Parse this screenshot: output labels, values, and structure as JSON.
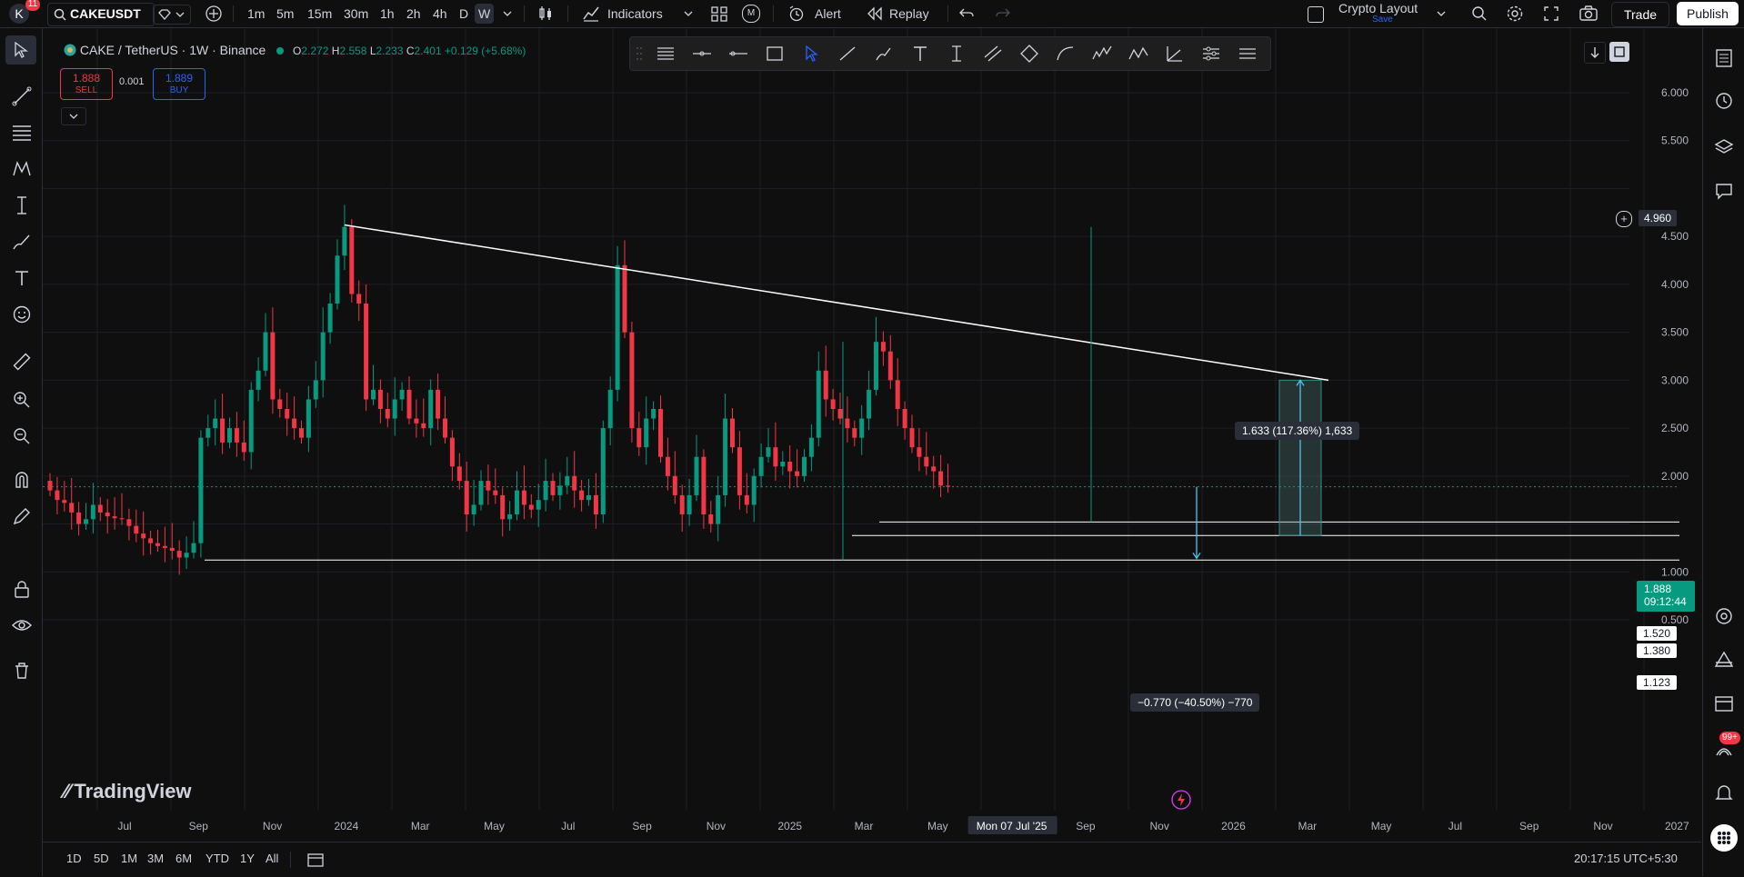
{
  "header": {
    "avatar_letter": "K",
    "notif_count": "11",
    "symbol": "CAKEUSDT",
    "intervals": [
      "1m",
      "5m",
      "15m",
      "30m",
      "1h",
      "2h",
      "4h",
      "D",
      "W"
    ],
    "active_interval": "W",
    "indicators_label": "Indicators",
    "alert_label": "Alert",
    "replay_label": "Replay",
    "layout_name": "Crypto Layout",
    "layout_sub": "Save",
    "trade_label": "Trade",
    "publish_label": "Publish"
  },
  "legend": {
    "title": "CAKE / TetherUS · 1W · Binance",
    "open_label": "O",
    "open": "2.272",
    "high_label": "H",
    "high": "2.558",
    "low_label": "L",
    "low": "2.233",
    "close_label": "C",
    "close": "2.401",
    "change": "+0.129 (+5.68%)"
  },
  "order": {
    "sell_price": "1.888",
    "sell_label": "SELL",
    "spread": "0.001",
    "buy_price": "1.889",
    "buy_label": "BUY"
  },
  "price_axis": [
    "6.000",
    "5.500",
    "4.500",
    "4.000",
    "3.500",
    "3.000",
    "2.500",
    "2.000",
    "1.000",
    "0.500"
  ],
  "crosshair_price": "4.960",
  "current_price": "1.888",
  "countdown": "09:12:44",
  "level_tags": [
    "1.520",
    "1.380",
    "1.123"
  ],
  "time_axis": [
    "Jul",
    "Sep",
    "Nov",
    "2024",
    "Mar",
    "May",
    "Jul",
    "Sep",
    "Nov",
    "2025",
    "Mar",
    "May",
    "Mon 07 Jul '25",
    "Sep",
    "Nov",
    "2026",
    "Mar",
    "May",
    "Jul",
    "Sep",
    "Nov",
    "2027"
  ],
  "callouts": {
    "up": "1.633 (117.36%) 1,633",
    "down": "−0.770 (−40.50%) −770"
  },
  "watermark": "TradingView",
  "ranges": [
    "1D",
    "5D",
    "1M",
    "3M",
    "6M",
    "YTD",
    "1Y",
    "All"
  ],
  "clock": "20:17:15 UTC+5:30",
  "badge_99": "99+",
  "colors": {
    "up": "#089981",
    "down": "#f23645",
    "bg": "#0f0f0f",
    "line": "#ffffff",
    "accent": "#2962ff"
  },
  "chart_data": {
    "type": "candlestick",
    "title": "CAKE / TetherUS · 1W · Binance",
    "ylim": [
      0.3,
      6.2
    ],
    "trendline": {
      "from_price": 4.62,
      "to_price": 3.0
    },
    "horizontal_levels": [
      1.52,
      1.38,
      1.123
    ],
    "closes": [
      1.85,
      1.75,
      1.72,
      1.62,
      1.5,
      1.55,
      1.7,
      1.62,
      1.58,
      1.56,
      1.55,
      1.48,
      1.4,
      1.35,
      1.3,
      1.27,
      1.25,
      1.22,
      1.15,
      1.2,
      1.3,
      2.4,
      2.5,
      2.6,
      2.35,
      2.5,
      2.35,
      2.25,
      2.9,
      3.1,
      3.5,
      2.8,
      2.7,
      2.6,
      2.5,
      2.4,
      2.8,
      3.0,
      3.5,
      3.8,
      4.3,
      4.6,
      3.9,
      3.8,
      2.8,
      2.9,
      2.7,
      2.6,
      2.8,
      2.9,
      2.6,
      2.55,
      2.5,
      2.9,
      2.6,
      2.4,
      2.1,
      1.95,
      1.6,
      1.7,
      1.95,
      1.85,
      1.8,
      1.55,
      1.6,
      1.85,
      1.7,
      1.65,
      1.75,
      1.95,
      1.8,
      1.9,
      2.0,
      1.85,
      1.75,
      1.8,
      1.6,
      2.5,
      2.9,
      4.2,
      3.5,
      2.5,
      2.3,
      2.6,
      2.7,
      2.2,
      2.0,
      1.8,
      1.6,
      1.8,
      2.2,
      1.6,
      1.5,
      1.8,
      2.6,
      2.3,
      1.8,
      1.7,
      2.0,
      2.2,
      2.3,
      2.1,
      2.15,
      2.05,
      2.0,
      2.2,
      2.4,
      3.1,
      2.8,
      2.7,
      2.6,
      2.5,
      2.4,
      2.6,
      2.9,
      3.4,
      3.3,
      3.0,
      2.7,
      2.5,
      2.3,
      2.2,
      2.1,
      2.05,
      1.9,
      1.888
    ]
  }
}
